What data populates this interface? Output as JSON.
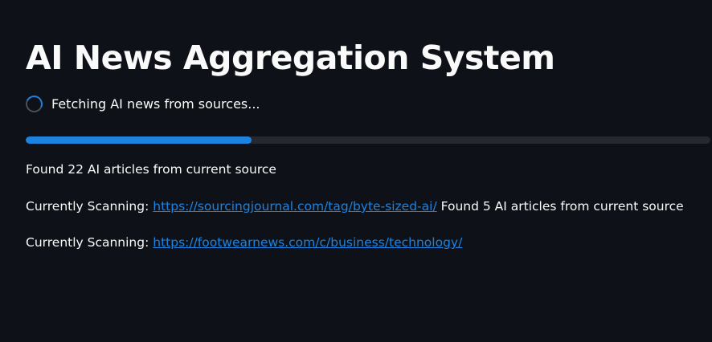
{
  "page": {
    "title": "AI News Aggregation System"
  },
  "status": {
    "spinner_icon": "loading-spinner-icon",
    "text": "Fetching AI news from sources..."
  },
  "progress": {
    "value": 0.33,
    "fill_color": "#1c83e1",
    "track_color": "#262730"
  },
  "log": {
    "line1": "Found 22 AI articles from current source",
    "line2": {
      "prefix": "Currently Scanning: ",
      "link": "https://sourcingjournal.com/tag/byte-sized-ai/",
      "suffix": " Found 5 AI articles from current source"
    },
    "line3": {
      "prefix": "Currently Scanning: ",
      "link": "https://footwearnews.com/c/business/technology/"
    }
  },
  "colors": {
    "background": "#0e1117",
    "text": "#fafafa",
    "link": "#1c83e1"
  }
}
